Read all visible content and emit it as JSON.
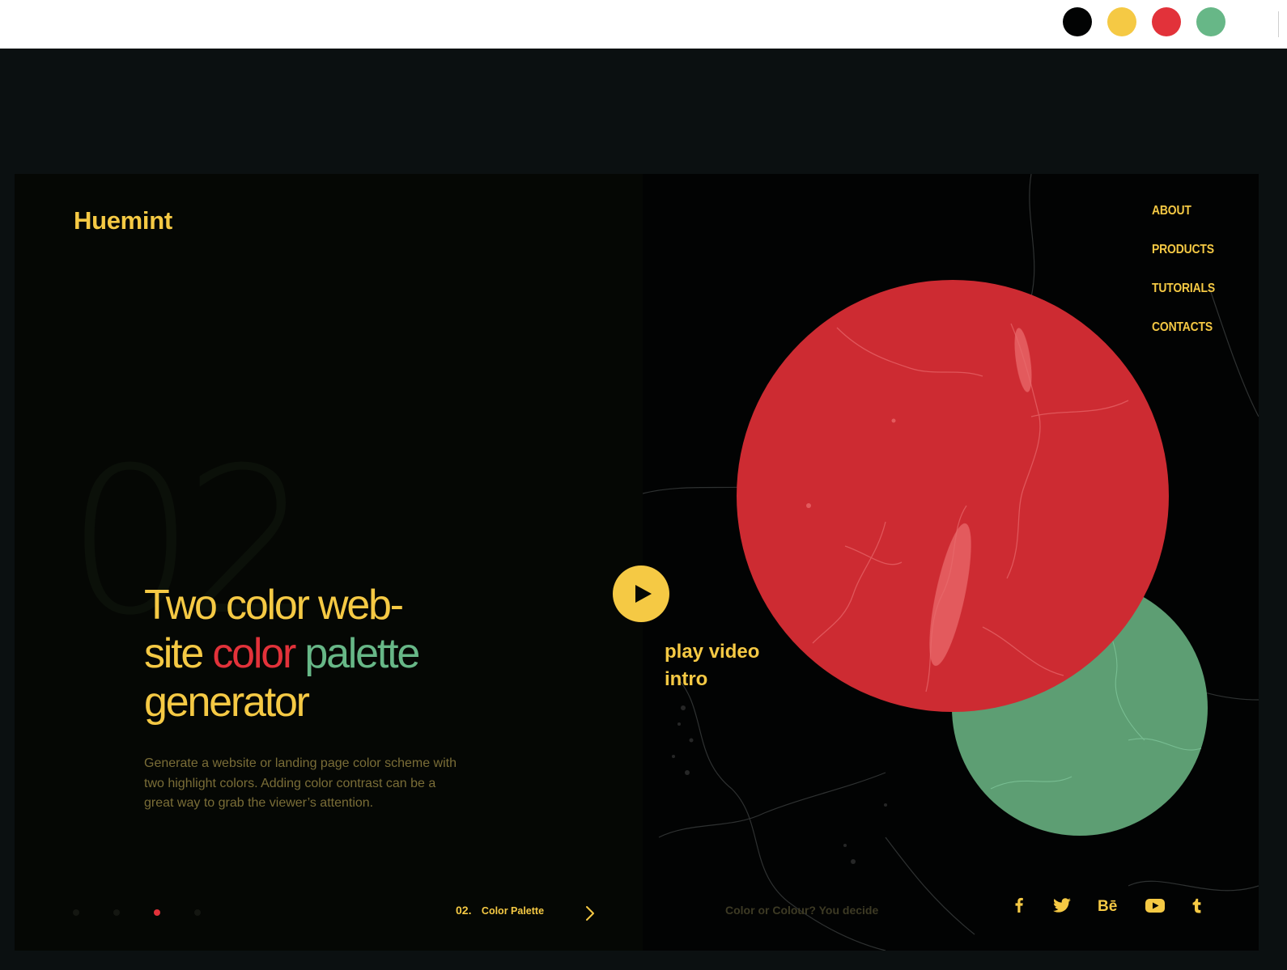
{
  "palette": {
    "swatches": [
      {
        "name": "black",
        "color": "#020303"
      },
      {
        "name": "yellow",
        "color": "#f5c944"
      },
      {
        "name": "red",
        "color": "#e2323a"
      },
      {
        "name": "green",
        "color": "#67b787"
      }
    ],
    "page_background": "#0b1011",
    "panel_left": "#050704",
    "panel_right": "#020303",
    "accent": "#f5c944",
    "muted_text": "#7a6d37",
    "red": "#cd2b32",
    "green": "#5d9e73"
  },
  "brand": {
    "logo": "Huemint"
  },
  "hero": {
    "big_number": "02",
    "headline_line1": "Two color web-",
    "headline_word_site": "site",
    "headline_word_color": "color",
    "headline_word_palette": "palette",
    "headline_line3": "generator",
    "description": "Generate a website or landing page color scheme with two highlight colors. Adding color contrast can be a great way to grab the viewer’s attention."
  },
  "pager": {
    "dots": [
      "slide-1",
      "slide-2",
      "slide-3",
      "slide-4"
    ],
    "active_index": 2,
    "slide_number": "02.",
    "slide_title": "Color Palette",
    "next_icon": "chevron-right-icon"
  },
  "video": {
    "play_icon": "play-icon",
    "label_line1": "play video",
    "label_line2": "intro"
  },
  "nav": {
    "items": [
      "ABOUT",
      "PRODUCTS",
      "TUTORIALS",
      "CONTACTS"
    ]
  },
  "footer": {
    "note": "Color or Colour? You decide",
    "socials": [
      {
        "name": "facebook-icon",
        "glyph": "f"
      },
      {
        "name": "twitter-icon",
        "glyph": "twitter"
      },
      {
        "name": "behance-icon",
        "glyph": "Bē"
      },
      {
        "name": "youtube-icon",
        "glyph": "youtube"
      },
      {
        "name": "tumblr-icon",
        "glyph": "t"
      }
    ]
  }
}
